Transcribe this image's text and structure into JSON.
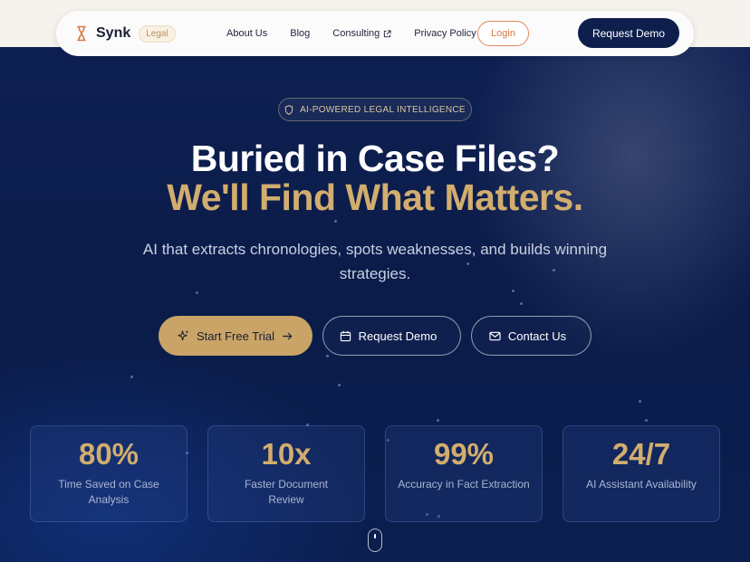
{
  "nav": {
    "brand": "Synk",
    "badge": "Legal",
    "links": [
      "About Us",
      "Blog",
      "Consulting",
      "Privacy Policy"
    ],
    "login_label": "Login",
    "demo_label": "Request Demo"
  },
  "hero": {
    "tag": "AI-POWERED LEGAL INTELLIGENCE",
    "headline_line1": "Buried in Case Files?",
    "headline_line2": "We'll Find What Matters.",
    "subtitle": "AI that extracts chronologies, spots weaknesses, and builds winning strategies.",
    "cta_primary": "Start Free Trial",
    "cta_demo": "Request Demo",
    "cta_contact": "Contact Us"
  },
  "stats": [
    {
      "value": "80%",
      "label": "Time Saved on Case Analysis"
    },
    {
      "value": "10x",
      "label": "Faster Document Review"
    },
    {
      "value": "99%",
      "label": "Accuracy in Fact Extraction"
    },
    {
      "value": "24/7",
      "label": "AI Assistant Availability"
    }
  ],
  "colors": {
    "navy": "#0f1f4d",
    "gold": "#d2ad6e",
    "accent_orange": "#d9783f"
  }
}
